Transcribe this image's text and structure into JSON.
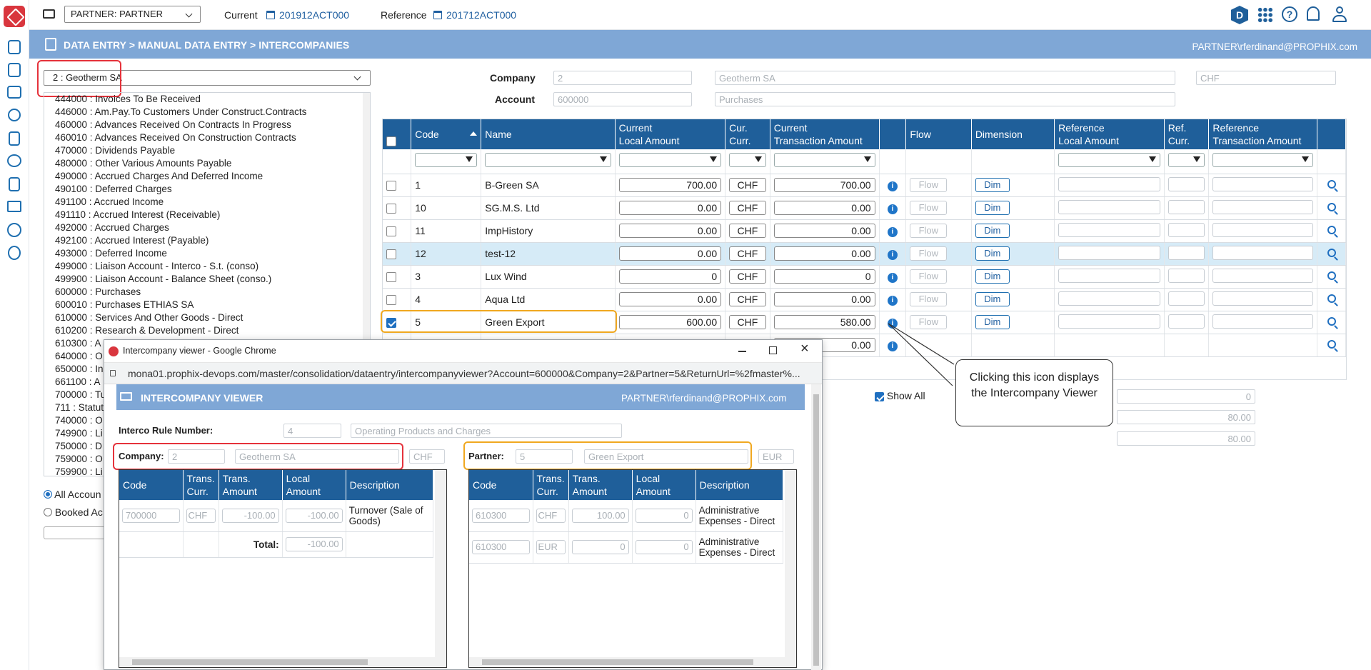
{
  "topbar": {
    "folder_icon": "folder-icon",
    "partner_select": "PARTNER: PARTNER",
    "current_label": "Current",
    "current_value": "201912ACT000",
    "reference_label": "Reference",
    "reference_value": "201712ACT000",
    "user_badge": "D",
    "icons": [
      "apps-grid-icon",
      "help-icon",
      "bell-icon",
      "user-icon"
    ]
  },
  "band": {
    "breadcrumb": "DATA ENTRY > MANUAL DATA ENTRY > INTERCOMPANIES",
    "user": "PARTNER\\rferdinand@PROPHIX.com"
  },
  "left": {
    "company_select": "2 : Geotherm SA",
    "accounts": [
      "444000 : Invoices To Be Received",
      "446000 : Am.Pay.To Customers Under Construct.Contracts",
      "460000 : Advances Received On Contracts In Progress",
      "460010 : Advances Received On Construction Contracts",
      "470000 : Dividends Payable",
      "480000 : Other Various Amounts Payable",
      "490000 : Accrued Charges And Deferred Income",
      "490100 : Deferred Charges",
      "491100 : Accrued Income",
      "491110 : Accrued Interest (Receivable)",
      "492000 : Accrued Charges",
      "492100 : Accrued Interest (Payable)",
      "493000 : Deferred Income",
      "499000 : Liaison Account - Interco - S.t. (conso)",
      "499900 : Liaison Account - Balance Sheet (conso.)",
      "600000 : Purchases",
      "600010 : Purchases ETHIAS SA",
      "610000 : Services And Other Goods - Direct",
      "610200 : Research & Development - Direct",
      "610300 : A",
      "640000 : O",
      "650000 : In",
      "661100 : A",
      "700000 : Tu",
      "711 : Statut",
      "740000 : O",
      "749900 : Li",
      "750000 : D",
      "759000 : O",
      "759900 : Li"
    ],
    "radio_all": "All Accoun",
    "radio_booked": "Booked Ac"
  },
  "form": {
    "company_label": "Company",
    "company_code": "2",
    "company_name": "Geotherm SA",
    "company_currency": "CHF",
    "account_label": "Account",
    "account_code": "600000",
    "account_name": "Purchases"
  },
  "grid": {
    "headers": {
      "code": "Code",
      "name": "Name",
      "cur_local_1": "Current",
      "cur_local_2": "Local Amount",
      "cur_curr_1": "Cur.",
      "cur_curr_2": "Curr.",
      "cur_trans_1": "Current",
      "cur_trans_2": "Transaction Amount",
      "flow": "Flow",
      "dimension": "Dimension",
      "ref_local_1": "Reference",
      "ref_local_2": "Local Amount",
      "ref_curr_1": "Ref.",
      "ref_curr_2": "Curr.",
      "ref_trans_1": "Reference",
      "ref_trans_2": "Transaction Amount"
    },
    "flow_label": "Flow",
    "dim_label": "Dim",
    "rows": [
      {
        "code": "1",
        "name": "B-Green SA",
        "local": "700.00",
        "curr": "CHF",
        "trans": "700.00"
      },
      {
        "code": "10",
        "name": "SG.M.S. Ltd",
        "local": "0.00",
        "curr": "CHF",
        "trans": "0.00"
      },
      {
        "code": "11",
        "name": "ImpHistory",
        "local": "0.00",
        "curr": "CHF",
        "trans": "0.00"
      },
      {
        "code": "12",
        "name": "test-12",
        "local": "0.00",
        "curr": "CHF",
        "trans": "0.00"
      },
      {
        "code": "3",
        "name": "Lux Wind",
        "local": "0",
        "curr": "CHF",
        "trans": "0"
      },
      {
        "code": "4",
        "name": "Aqua Ltd",
        "local": "0.00",
        "curr": "CHF",
        "trans": "0.00"
      },
      {
        "code": "5",
        "name": "Green Export",
        "local": "600.00",
        "curr": "CHF",
        "trans": "580.00"
      },
      {
        "code": "",
        "name": "",
        "local": "",
        "curr": "",
        "trans": "0.00"
      }
    ],
    "show_all": "Show All",
    "totals": [
      "0",
      "80.00",
      "80.00"
    ]
  },
  "callout": {
    "text": "Clicking this icon displays the Intercompany Viewer"
  },
  "popup": {
    "window_title": "Intercompany viewer - Google Chrome",
    "url": "mona01.prophix-devops.com/master/consolidation/dataentry/intercompanyviewer?Account=600000&Company=2&Partner=5&ReturnUrl=%2fmaster%...",
    "header": "INTERCOMPANY VIEWER",
    "user": "PARTNER\\rferdinand@PROPHIX.com",
    "rule_label": "Interco Rule Number:",
    "rule_number": "4",
    "rule_name": "Operating Products and Charges",
    "company_label": "Company:",
    "company_code": "2",
    "company_name": "Geotherm SA",
    "company_curr": "CHF",
    "partner_label": "Partner:",
    "partner_code": "5",
    "partner_name": "Green Export",
    "partner_curr": "EUR",
    "headers": {
      "code": "Code",
      "tc1": "Trans.",
      "tc2": "Curr.",
      "ta1": "Trans.",
      "ta2": "Amount",
      "la1": "Local",
      "la2": "Amount",
      "desc": "Description"
    },
    "left_rows": [
      {
        "code": "700000",
        "curr": "CHF",
        "trans": "-100.00",
        "local": "-100.00",
        "desc": "Turnover (Sale of Goods)"
      }
    ],
    "total_label": "Total:",
    "total_value": "-100.00",
    "right_rows": [
      {
        "code": "610300",
        "curr": "CHF",
        "trans": "100.00",
        "local": "0",
        "desc": "Administrative Expenses - Direct"
      },
      {
        "code": "610300",
        "curr": "EUR",
        "trans": "0",
        "local": "0",
        "desc": "Administrative Expenses - Direct"
      }
    ]
  },
  "colors": {
    "accent": "#1f5f9a",
    "band": "#7fa7d6",
    "highlight_red": "#e5323b",
    "highlight_orange": "#f0a820",
    "logo": "#d9363e"
  }
}
